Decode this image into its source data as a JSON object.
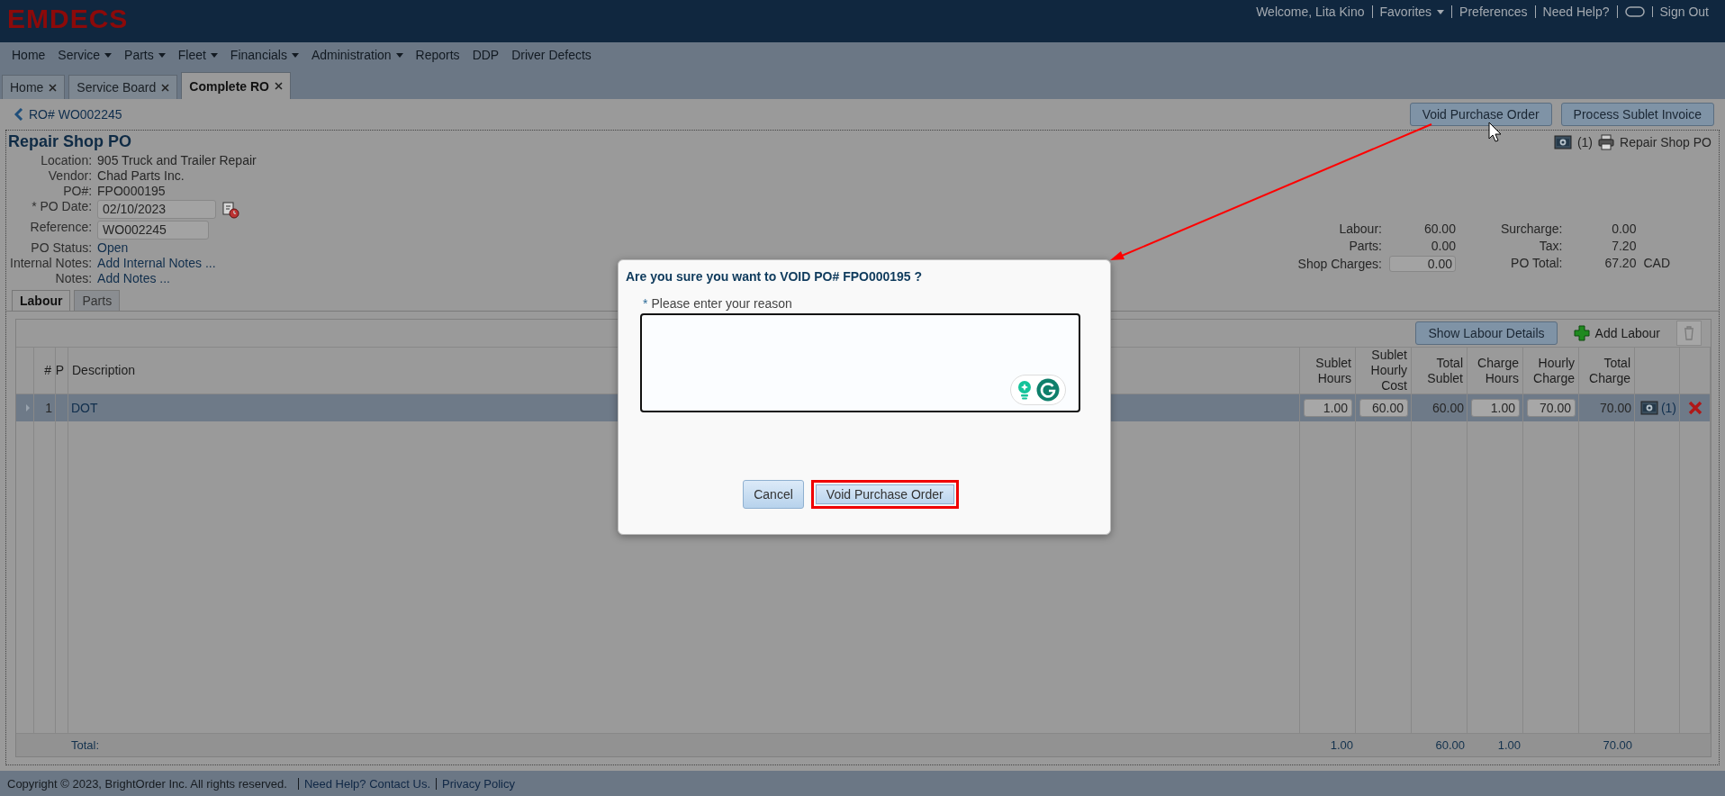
{
  "header": {
    "logo": "EMDECS",
    "links": [
      {
        "label": "Welcome, Lita Kino",
        "kind": "text"
      },
      {
        "label": "Favorites",
        "kind": "dropdown"
      },
      {
        "label": "Preferences",
        "kind": "link"
      },
      {
        "label": "Need Help?",
        "kind": "link"
      },
      {
        "kind": "icon"
      },
      {
        "label": "Sign Out",
        "kind": "link"
      }
    ]
  },
  "nav": [
    {
      "label": "Home",
      "dropdown": false
    },
    {
      "label": "Service",
      "dropdown": true
    },
    {
      "label": "Parts",
      "dropdown": true
    },
    {
      "label": "Fleet",
      "dropdown": true
    },
    {
      "label": "Financials",
      "dropdown": true
    },
    {
      "label": "Administration",
      "dropdown": true
    },
    {
      "label": "Reports",
      "dropdown": false
    },
    {
      "label": "DDP",
      "dropdown": false
    },
    {
      "label": "Driver Defects",
      "dropdown": false
    }
  ],
  "doc_tabs": [
    {
      "label": "Home",
      "selected": false
    },
    {
      "label": "Service Board",
      "selected": false
    },
    {
      "label": "Complete RO",
      "selected": true
    }
  ],
  "breadcrumb": "RO# WO002245",
  "actions": [
    "Void Purchase Order",
    "Process Sublet Invoice"
  ],
  "attachments": {
    "count": "(1)",
    "print_label": "Repair Shop PO"
  },
  "po": {
    "title": "Repair Shop PO",
    "fields": [
      {
        "label": "Location:",
        "value": "905 Truck and Trailer Repair",
        "kind": "text"
      },
      {
        "label": "Vendor:",
        "value": "Chad Parts Inc.",
        "kind": "text"
      },
      {
        "label": "PO#:",
        "value": "FPO000195",
        "kind": "text"
      },
      {
        "label": "* PO Date:",
        "value": "02/10/2023",
        "kind": "date"
      },
      {
        "label": "Reference:",
        "value": "WO002245",
        "kind": "input"
      },
      {
        "label": "PO Status:",
        "value": "Open",
        "kind": "link"
      },
      {
        "label": "Internal Notes:",
        "value": "Add Internal Notes ...",
        "kind": "link"
      },
      {
        "label": "Notes:",
        "value": "Add Notes ...",
        "kind": "link"
      }
    ]
  },
  "summary": {
    "left": [
      {
        "label": "Labour:",
        "value": "60.00",
        "kind": "text"
      },
      {
        "label": "Parts:",
        "value": "0.00",
        "kind": "text"
      },
      {
        "label": "Shop Charges:",
        "value": "0.00",
        "kind": "input"
      }
    ],
    "right": [
      {
        "label": "Surcharge:",
        "value": "0.00"
      },
      {
        "label": "Tax:",
        "value": "7.20"
      },
      {
        "label": "PO Total:",
        "value": "67.20",
        "currency": "CAD"
      }
    ]
  },
  "sub_tabs": [
    {
      "label": "Labour",
      "selected": true
    },
    {
      "label": "Parts",
      "selected": false
    }
  ],
  "toolbar": {
    "details_button": "Show Labour Details",
    "add_button": "Add Labour"
  },
  "table": {
    "columns": [
      "#",
      "P",
      "Description",
      "Sublet Hours",
      "Sublet Hourly Cost",
      "Total Sublet",
      "Charge Hours",
      "Hourly Charge",
      "Total Charge"
    ],
    "rows": [
      {
        "number": "1",
        "description": "DOT",
        "sublet_hours": "1.00",
        "sublet_hourly_cost": "60.00",
        "total_sublet": "60.00",
        "charge_hours": "1.00",
        "hourly_charge": "70.00",
        "total_charge": "70.00",
        "attachments": "(1)",
        "selected": true
      }
    ],
    "totals": {
      "label": "Total:",
      "sublet_hours": "1.00",
      "total_sublet": "60.00",
      "charge_hours": "1.00",
      "total_charge": "70.00"
    }
  },
  "dialog": {
    "title": "Are you sure you want to VOID PO# FPO000195 ?",
    "required_mark": "*",
    "field_label": "Please enter your reason",
    "buttons": [
      {
        "label": "Cancel",
        "highlighted": false
      },
      {
        "label": "Void Purchase Order",
        "highlighted": true
      }
    ]
  },
  "footer": {
    "copyright": "Copyright © 2023, BrightOrder Inc. All rights reserved.",
    "links": [
      "Need Help? Contact Us.",
      "Privacy Policy"
    ]
  }
}
